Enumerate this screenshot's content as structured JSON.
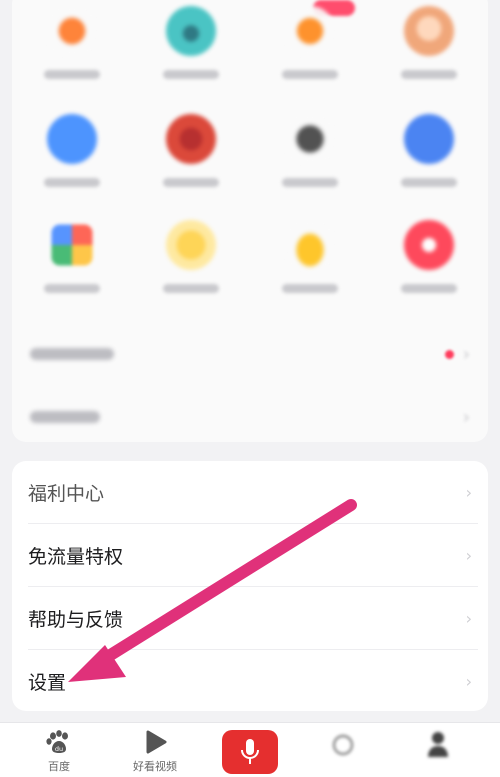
{
  "menu": {
    "items": [
      {
        "label": "福利中心"
      },
      {
        "label": "免流量特权"
      },
      {
        "label": "帮助与反馈"
      },
      {
        "label": "设置"
      }
    ],
    "chevron": "›"
  },
  "tabbar": {
    "tabs": [
      {
        "label": "百度",
        "icon": "baidu-paw-icon"
      },
      {
        "label": "好看视频",
        "icon": "play-icon"
      },
      {
        "label": "",
        "icon": "mic-icon"
      },
      {
        "label": "",
        "icon": "message-icon"
      },
      {
        "label": "",
        "icon": "profile-icon"
      }
    ]
  },
  "colors": {
    "accent_red": "#e52f2f",
    "arrow": "#e0317a"
  }
}
